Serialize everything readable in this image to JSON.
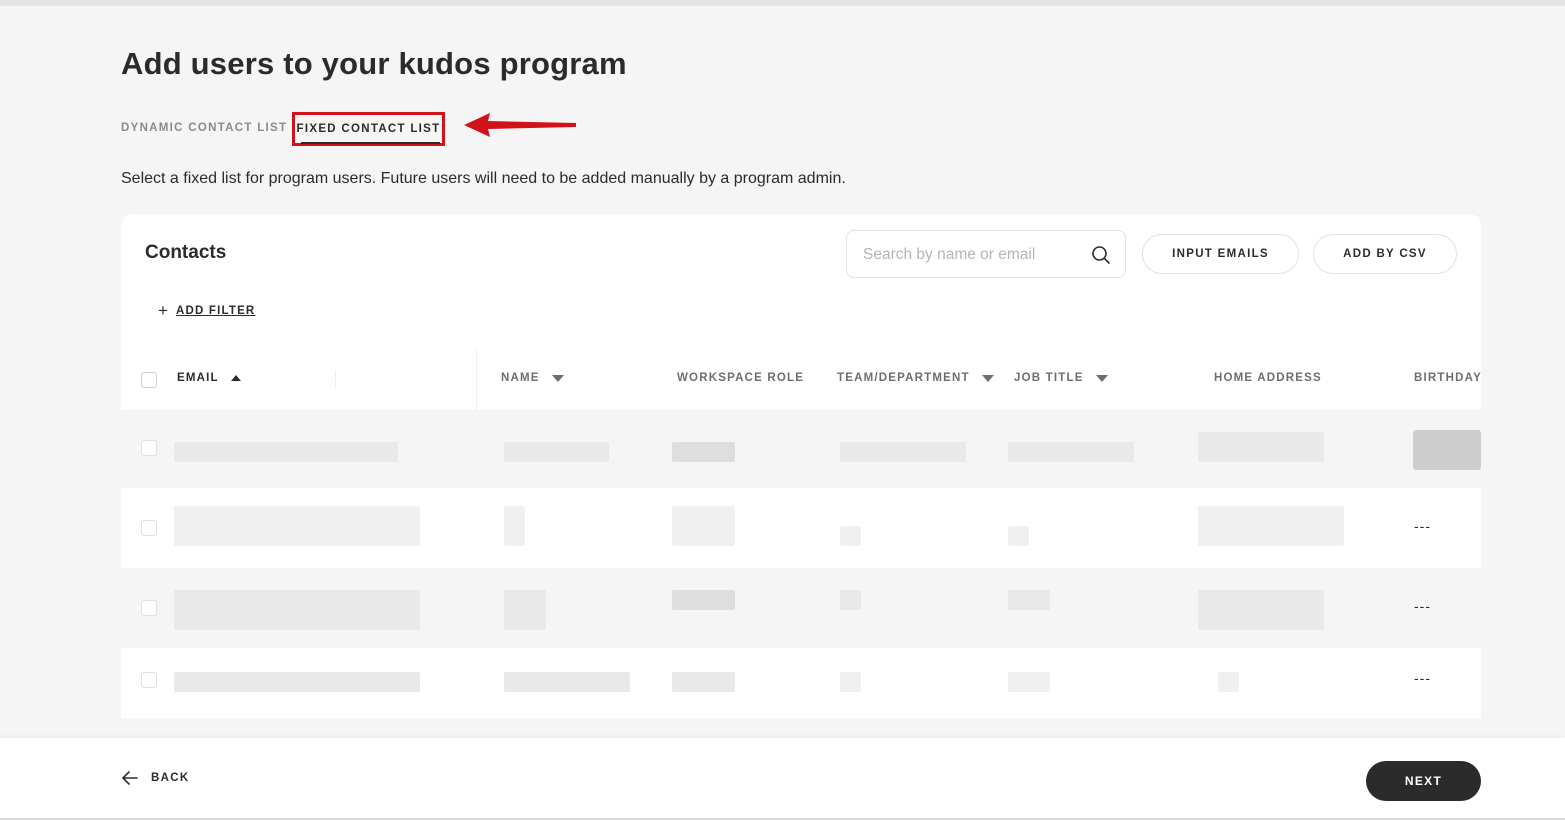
{
  "page": {
    "title": "Add users to your kudos program",
    "subtitle": "Select a fixed list for program users. Future users will need to be added manually by a program admin."
  },
  "tabs": {
    "dynamic_label": "DYNAMIC CONTACT LIST",
    "fixed_label": "FIXED CONTACT LIST",
    "active": "fixed"
  },
  "contacts": {
    "title": "Contacts",
    "search_placeholder": "Search by name or email",
    "search_value": "",
    "input_emails_label": "INPUT EMAILS",
    "add_by_csv_label": "ADD BY CSV",
    "add_filter_label": "ADD FILTER"
  },
  "table": {
    "columns": [
      {
        "label": "EMAIL",
        "sort": "ascending"
      },
      {
        "label": "NAME",
        "sort": "dropdown"
      },
      {
        "label": "WORKSPACE ROLE",
        "sort": "none"
      },
      {
        "label": "TEAM/DEPARTMENT",
        "sort": "dropdown"
      },
      {
        "label": "JOB TITLE",
        "sort": "dropdown"
      },
      {
        "label": "HOME ADDRESS",
        "sort": "none"
      },
      {
        "label": "BIRTHDAY",
        "sort": "none"
      }
    ],
    "rows": [
      {
        "birthday": ""
      },
      {
        "birthday": "---"
      },
      {
        "birthday": "---"
      },
      {
        "birthday": "---"
      }
    ]
  },
  "footer": {
    "back_label": "BACK",
    "next_label": "NEXT"
  },
  "colors": {
    "accent_dark": "#2b2b2b",
    "highlight_red": "#d0121b",
    "background": "#f5f5f5"
  }
}
